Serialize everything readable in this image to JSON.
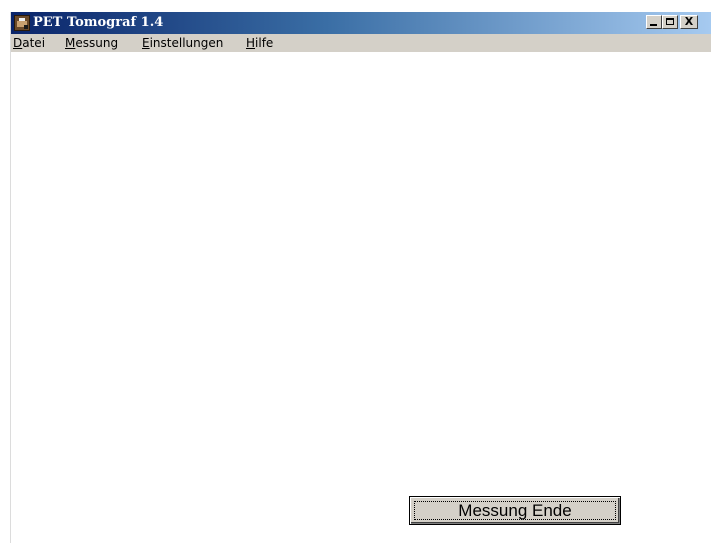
{
  "window": {
    "title": "PET Tomograf 1.4",
    "icon": "app-icon",
    "controls": {
      "minimize": "minimize-icon",
      "maximize": "maximize-icon",
      "close_glyph": "X"
    }
  },
  "menu": {
    "items": [
      {
        "mnemonic": "D",
        "rest": "atei"
      },
      {
        "mnemonic": "M",
        "rest": "essung"
      },
      {
        "mnemonic": "E",
        "rest": "instellungen"
      },
      {
        "mnemonic": "H",
        "rest": "ilfe"
      }
    ]
  },
  "main": {
    "end_button_label": "Messung Ende"
  }
}
